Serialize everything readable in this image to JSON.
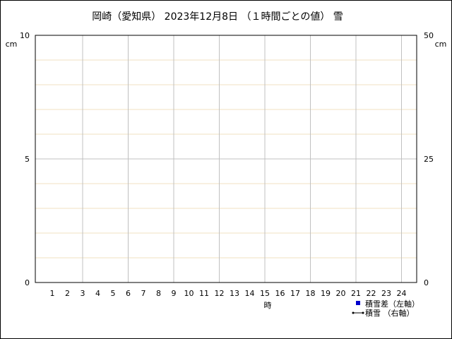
{
  "chart_data": {
    "type": "bar",
    "title": "岡崎（愛知県） 2023年12月8日 （１時間ごとの値） 雪",
    "xlabel": "時",
    "ylabel_left": "cm",
    "ylabel_right": "cm",
    "categories": [
      "1",
      "2",
      "3",
      "4",
      "5",
      "6",
      "7",
      "8",
      "9",
      "10",
      "11",
      "12",
      "13",
      "14",
      "15",
      "16",
      "17",
      "18",
      "19",
      "20",
      "21",
      "22",
      "23",
      "24"
    ],
    "ylim_left": [
      0,
      10
    ],
    "ylim_right": [
      0,
      50
    ],
    "yticks_left": [
      0,
      5,
      10
    ],
    "yticks_right": [
      0,
      25,
      50
    ],
    "grid": true,
    "legend_position": "bottom-right",
    "series": [
      {
        "name": "積雪差（左軸）",
        "type": "bar",
        "axis": "left",
        "color": "#0000cc",
        "values": []
      },
      {
        "name": "積雪 （右軸）",
        "type": "line",
        "axis": "right",
        "color": "#000000",
        "values": []
      }
    ]
  }
}
